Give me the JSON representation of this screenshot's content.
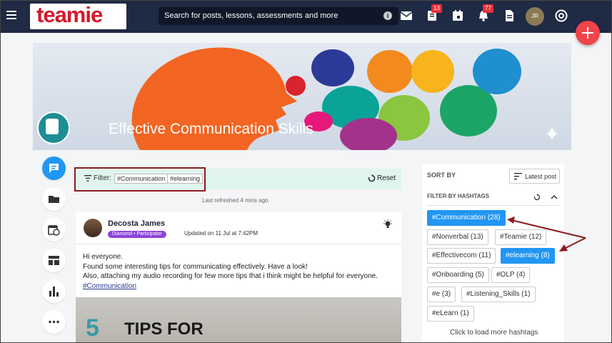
{
  "topbar": {
    "logo_text": "teamie",
    "search_placeholder": "Search for posts, lessons, assessments and more",
    "info_glyph": "i",
    "messages_badge": "13",
    "notifications_badge": "77",
    "avatar_initials": "JR"
  },
  "banner": {
    "title": "Effective Communication Skills"
  },
  "rail": {
    "items": [
      "posts-icon",
      "folder-icon",
      "calendar-clock-icon",
      "dashboard-icon",
      "bar-chart-icon",
      "more-icon"
    ]
  },
  "filter": {
    "label": "Filter:",
    "chips": [
      "#Communication",
      "#elearning"
    ],
    "reset_label": "Reset",
    "refreshed": "Last refreshed 4 mins ago."
  },
  "post": {
    "author": "Decosta James",
    "role": "Diamond • Participator",
    "updated": "Updated on 11 Jul at 7:42PM",
    "lines": [
      "Hi everyone.",
      "Found some interesting tips for communicating effectively. Have a look!",
      "Also, attaching my audio recording for few more tips that i think might be helpful for everyone."
    ],
    "hashtag_link": "#Communication",
    "image_number": "5",
    "image_text": "TIPS FOR"
  },
  "sidebar": {
    "sort_label": "SORT BY",
    "sort_value": "Latest post",
    "hashtag_label": "FILTER BY HASHTAGS",
    "tags": [
      {
        "label": "#Communication (28)",
        "active": true
      },
      {
        "label": "#Nonverbal (13)",
        "active": false
      },
      {
        "label": "#Teamie (12)",
        "active": false
      },
      {
        "label": "#Effectivecom (11)",
        "active": false
      },
      {
        "label": "#elearning (8)",
        "active": true
      },
      {
        "label": "#Onboarding (5)",
        "active": false
      },
      {
        "label": "#OLP (4)",
        "active": false
      },
      {
        "label": "#e (3)",
        "active": false
      },
      {
        "label": "#Listening_Skills (1)",
        "active": false
      },
      {
        "label": "#eLearn (1)",
        "active": false
      }
    ],
    "load_more": "Click to load more hashtags"
  },
  "colors": {
    "topbar": "#1f2a44",
    "accent": "#2196f3",
    "fab": "#f0434a",
    "annotation": "#8b1c1c"
  }
}
